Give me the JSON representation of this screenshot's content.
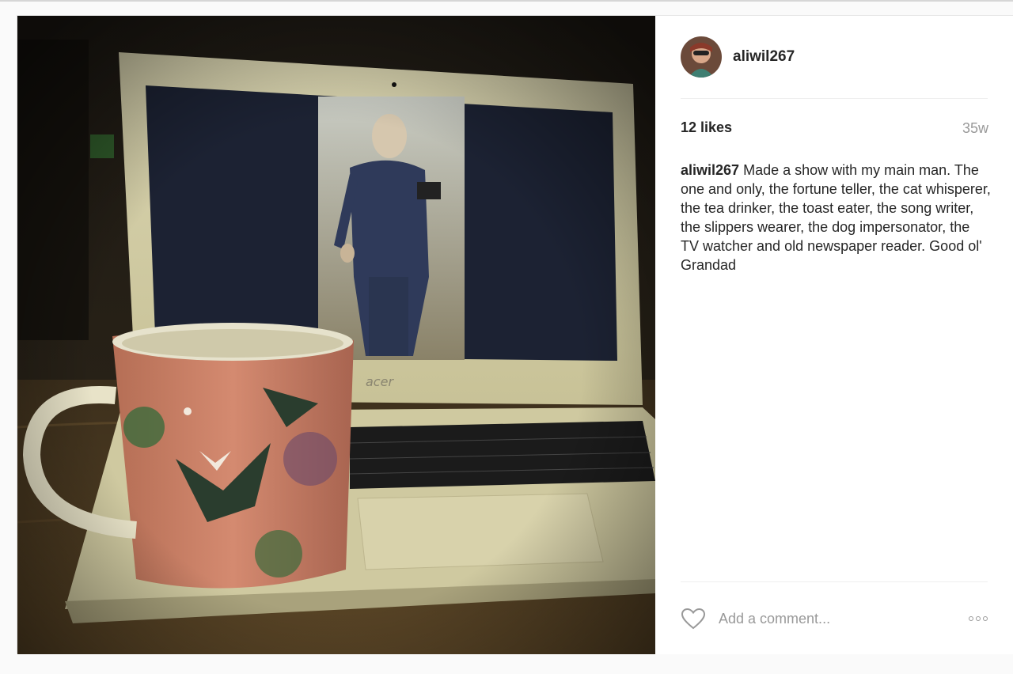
{
  "post": {
    "author": {
      "username": "aliwil267"
    },
    "likes_text": "12 likes",
    "timestamp": "35w",
    "caption": {
      "username": "aliwil267",
      "text": "Made a show with my main man. The one and only, the fortune teller, the cat whisperer, the tea drinker, the toast eater, the song writer, the slippers wearer, the dog impersonator, the TV watcher and old newspaper reader. Good ol' Grandad"
    },
    "photo": {
      "laptop_brand": "acer"
    },
    "comment_box": {
      "placeholder": "Add a comment..."
    },
    "icons": {
      "like": "heart-icon",
      "more": "more-options-icon"
    },
    "colors": {
      "username": "#262626",
      "muted": "#999999",
      "divider": "#efefef"
    }
  }
}
